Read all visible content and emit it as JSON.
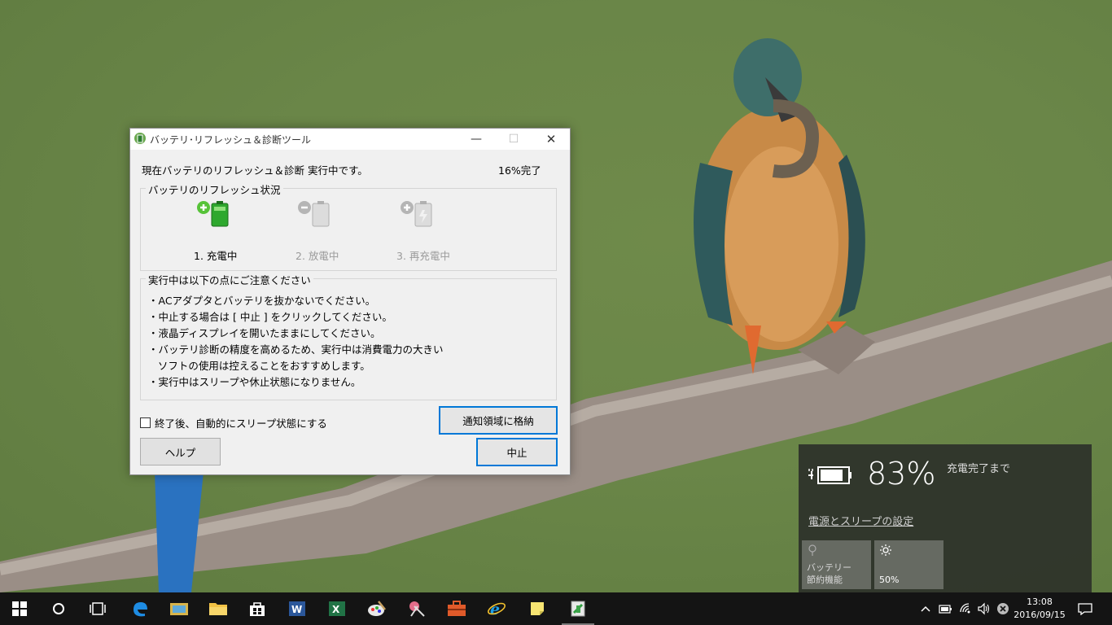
{
  "dialog": {
    "title": "バッテリ･リフレッシュ＆診断ツール",
    "status": "現在バッテリのリフレッシュ＆診断 実行中です。",
    "progress": "16%完了",
    "progress_value": 16,
    "refresh_group": {
      "title": "バッテリのリフレッシュ状況",
      "steps": [
        {
          "label": "1. 充電中",
          "active": true
        },
        {
          "label": "2. 放電中",
          "active": false
        },
        {
          "label": "3. 再充電中",
          "active": false
        }
      ]
    },
    "notes_group": {
      "title": "実行中は以下の点にご注意ください",
      "lines": [
        "・ACアダプタとバッテリを抜かないでください。",
        "・中止する場合は [ 中止 ] をクリックしてください。",
        "・液晶ディスプレイを開いたままにしてください。",
        "・バッテリ診断の精度を高めるため、実行中は消費電力の大きい",
        "   ソフトの使用は控えることをおすすめします。",
        "・実行中はスリープや休止状態になりません。"
      ]
    },
    "auto_sleep_label": "終了後、自動的にスリープ状態にする",
    "auto_sleep_checked": false,
    "tray_button": "通知領域に格納",
    "help_button": "ヘルプ",
    "stop_button": "中止"
  },
  "battery_flyout": {
    "percent": "83%",
    "percent_value": 83,
    "status": "充電完了まで",
    "settings_link": "電源とスリープの設定",
    "tiles": [
      {
        "label": "バッテリー\n節約機能",
        "icon": "battery-saver-icon"
      },
      {
        "label": "50%",
        "icon": "brightness-icon"
      }
    ]
  },
  "taskbar": {
    "apps": [
      "start-icon",
      "cortana-icon",
      "task-view-icon",
      "edge-icon",
      "file-manager-icon",
      "explorer-icon",
      "store-icon",
      "word-icon",
      "excel-icon",
      "paint-icon",
      "snipping-icon",
      "toolbox-icon",
      "ie-icon",
      "sticky-notes-icon",
      "battery-tool-icon"
    ],
    "clock": {
      "time": "13:08",
      "date": "2016/09/15"
    }
  },
  "colors": {
    "accent": "#0078d7",
    "wallpaper": "#6a8648",
    "taskbar": "#141414"
  }
}
